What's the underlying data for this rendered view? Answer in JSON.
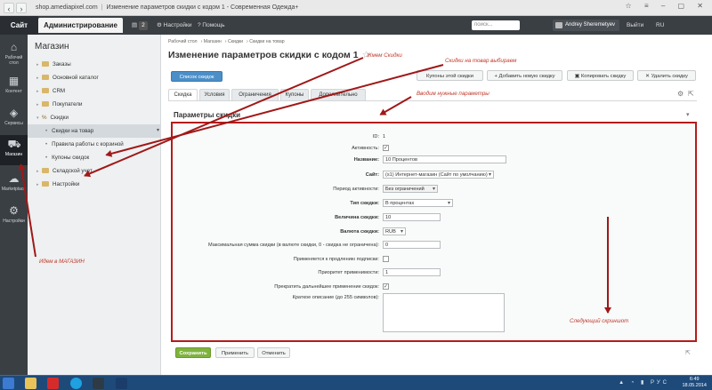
{
  "browser": {
    "url": "shop.amediapixel.com",
    "title": "Изменение параметров скидки с кодом 1 - Современная Одежда+"
  },
  "topbar": {
    "site_label": "Сайт",
    "admin_label": "Администрирование",
    "notifications_count": "2",
    "settings_label": "Настройки",
    "help_label": "Помощь",
    "search_placeholder": "поиск...",
    "user_name": "Andrey Sheremetyev",
    "logout_label": "Выйти",
    "lang": "RU"
  },
  "rail": {
    "items": [
      {
        "label": "Рабочий стол",
        "icon": "home-icon"
      },
      {
        "label": "Контент",
        "icon": "content-icon"
      },
      {
        "label": "Сервисы",
        "icon": "services-icon"
      },
      {
        "label": "Магазин",
        "icon": "cart-icon"
      },
      {
        "label": "Marketplace",
        "icon": "cloud-icon"
      },
      {
        "label": "Настройки",
        "icon": "gear-icon"
      }
    ]
  },
  "sidebar": {
    "title": "Магазин",
    "items": [
      {
        "label": "Заказы"
      },
      {
        "label": "Основной каталог"
      },
      {
        "label": "CRM"
      },
      {
        "label": "Покупатели"
      },
      {
        "label": "Скидки"
      },
      {
        "label": "Скидки на товар"
      },
      {
        "label": "Правила работы с корзиной"
      },
      {
        "label": "Купоны скидок"
      },
      {
        "label": "Складской учет"
      },
      {
        "label": "Настройки"
      }
    ]
  },
  "main": {
    "breadcrumbs": [
      "Рабочий стол",
      "Магазин",
      "Скидки",
      "Скидки на товар"
    ],
    "title": "Изменение параметров скидки с кодом 1",
    "toolbar": {
      "list": "Список скидок",
      "coupons": "Купоны этой скидки",
      "add": "Добавить новую скидку",
      "copy": "Копировать скидку",
      "delete": "Удалить скидку"
    },
    "tabs": [
      "Скидка",
      "Условия",
      "Ограничения",
      "Купоны",
      "Дополнительно"
    ],
    "section_title": "Параметры скидки",
    "form": {
      "id_label": "ID:",
      "id_value": "1",
      "active_label": "Активность:",
      "name_label": "Название:",
      "name_value": "10 Процентов",
      "site_label": "Сайт:",
      "site_value": "(s1) Интернет-магазин (Сайт по умолчанию)",
      "period_label": "Период активности:",
      "period_value": "Без ограничений",
      "type_label": "Тип скидки:",
      "type_value": "В процентах",
      "value_label": "Величина скидки:",
      "value_value": "10",
      "currency_label": "Валюта скидки:",
      "currency_value": "RUB",
      "max_label": "Максимальная сумма скидки (в валюте скидки, 0 - скидка не ограничена):",
      "max_value": "0",
      "renewal_label": "Применяется к продлению подписки:",
      "priority_label": "Приоритет применимости:",
      "priority_value": "1",
      "stop_label": "Прекратить дальнейшее применение скидок:",
      "desc_label": "Краткое описание (до 255 символов):"
    },
    "footer": {
      "save": "Сохранить",
      "apply": "Применить",
      "cancel": "Отменить"
    }
  },
  "annotations": {
    "a1": "Жмем Скидки",
    "a2": "Скидки на товар выбираем",
    "a3": "Вводим нужные параметры",
    "a4": "Идем в МАГАЗИН",
    "a5": "Следующий скриншот"
  },
  "taskbar": {
    "time": "6:49",
    "date": "18.05.2014",
    "lang": "РУС"
  }
}
